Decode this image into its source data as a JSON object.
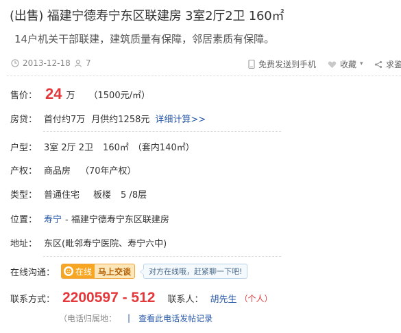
{
  "listing": {
    "title": "(出售) 福建宁德寿宁东区联建房 3室2厅2卫 160㎡",
    "subtitle": "14户机关干部联建，建筑质量有保障，邻居素质有保障。"
  },
  "meta": {
    "date": "2013-12-18",
    "views": "7",
    "send_to_phone": "免费发送到手机",
    "favorite": "收藏",
    "share": "求鉴"
  },
  "details": {
    "price_label": "售价：",
    "price_value": "24",
    "price_unit": "万",
    "price_per_sqm": "（1500元/㎡）",
    "loan_label": "房贷：",
    "loan_down": "首付约7万",
    "loan_monthly": "月供约1258元",
    "loan_link": "详细计算>>",
    "layout_label": "户型：",
    "layout_rooms": "3室 2厅 2卫",
    "layout_area": "160㎡",
    "layout_inner": "（套内140㎡）",
    "property_label": "产权：",
    "property_type": "商品房",
    "property_years": "（70年产权）",
    "type_label": "类型：",
    "type_kind": "普通住宅",
    "type_building": "板楼",
    "type_floor": "5 /8层",
    "location_label": "位置：",
    "location_link": "寿宁",
    "location_rest": "- 福建宁德寿宁东区联建房",
    "address_label": "地址：",
    "address_value": "东区(毗邻寿宁医院、寿宁六中)"
  },
  "contact": {
    "chat_label": "在线沟通：",
    "online_text": "在线",
    "chat_now": "马上交谈",
    "chat_tip": "对方在线哦，赶紧聊一下吧!",
    "phone_label": "联系方式：",
    "phone": "2200597 - 512",
    "person_label": "联系人：",
    "person_name": "胡先生",
    "person_tag": "（个人）",
    "phone_location": "（电话归属地：",
    "call_record_link": "查看此电话发帖记录"
  },
  "colors": {
    "price_red": "#e4393c",
    "link_blue": "#2a5aa8",
    "chat_orange": "#f6a623"
  }
}
